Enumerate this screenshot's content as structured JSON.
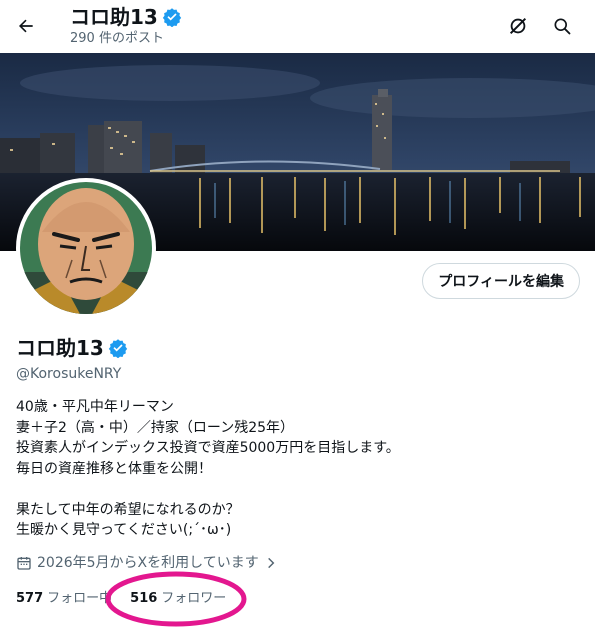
{
  "header": {
    "title": "コロ助13",
    "post_count": "290 件のポスト",
    "back_icon": "arrow-left-icon",
    "grok_icon": "grok-slash-icon",
    "search_icon": "search-icon"
  },
  "profile": {
    "name": "コロ助13",
    "handle": "@KorosukeNRY",
    "verified_icon": "verified-badge-icon",
    "edit_button_label": "プロフィールを編集",
    "bio_lines": [
      "40歳・平凡中年リーマン",
      "妻＋子2（高・中）／持家（ローン残25年）",
      "投資素人がインデックス投資で資産5000万円を目指します。",
      "毎日の資産推移と体重を公開！",
      "",
      "果たして中年の希望になれるのか？",
      "生暖かく見守ってください(;´･ω･)"
    ],
    "joined": "2026年5月からXを利用しています",
    "following_count": "577",
    "following_label": "フォロー中",
    "followers_count": "516",
    "followers_label": "フォロワー"
  },
  "colors": {
    "accent": "#1d9bf0",
    "text_primary": "#0f1419",
    "text_secondary": "#536471",
    "border": "#cfd9de",
    "annotation": "#e3178f"
  }
}
